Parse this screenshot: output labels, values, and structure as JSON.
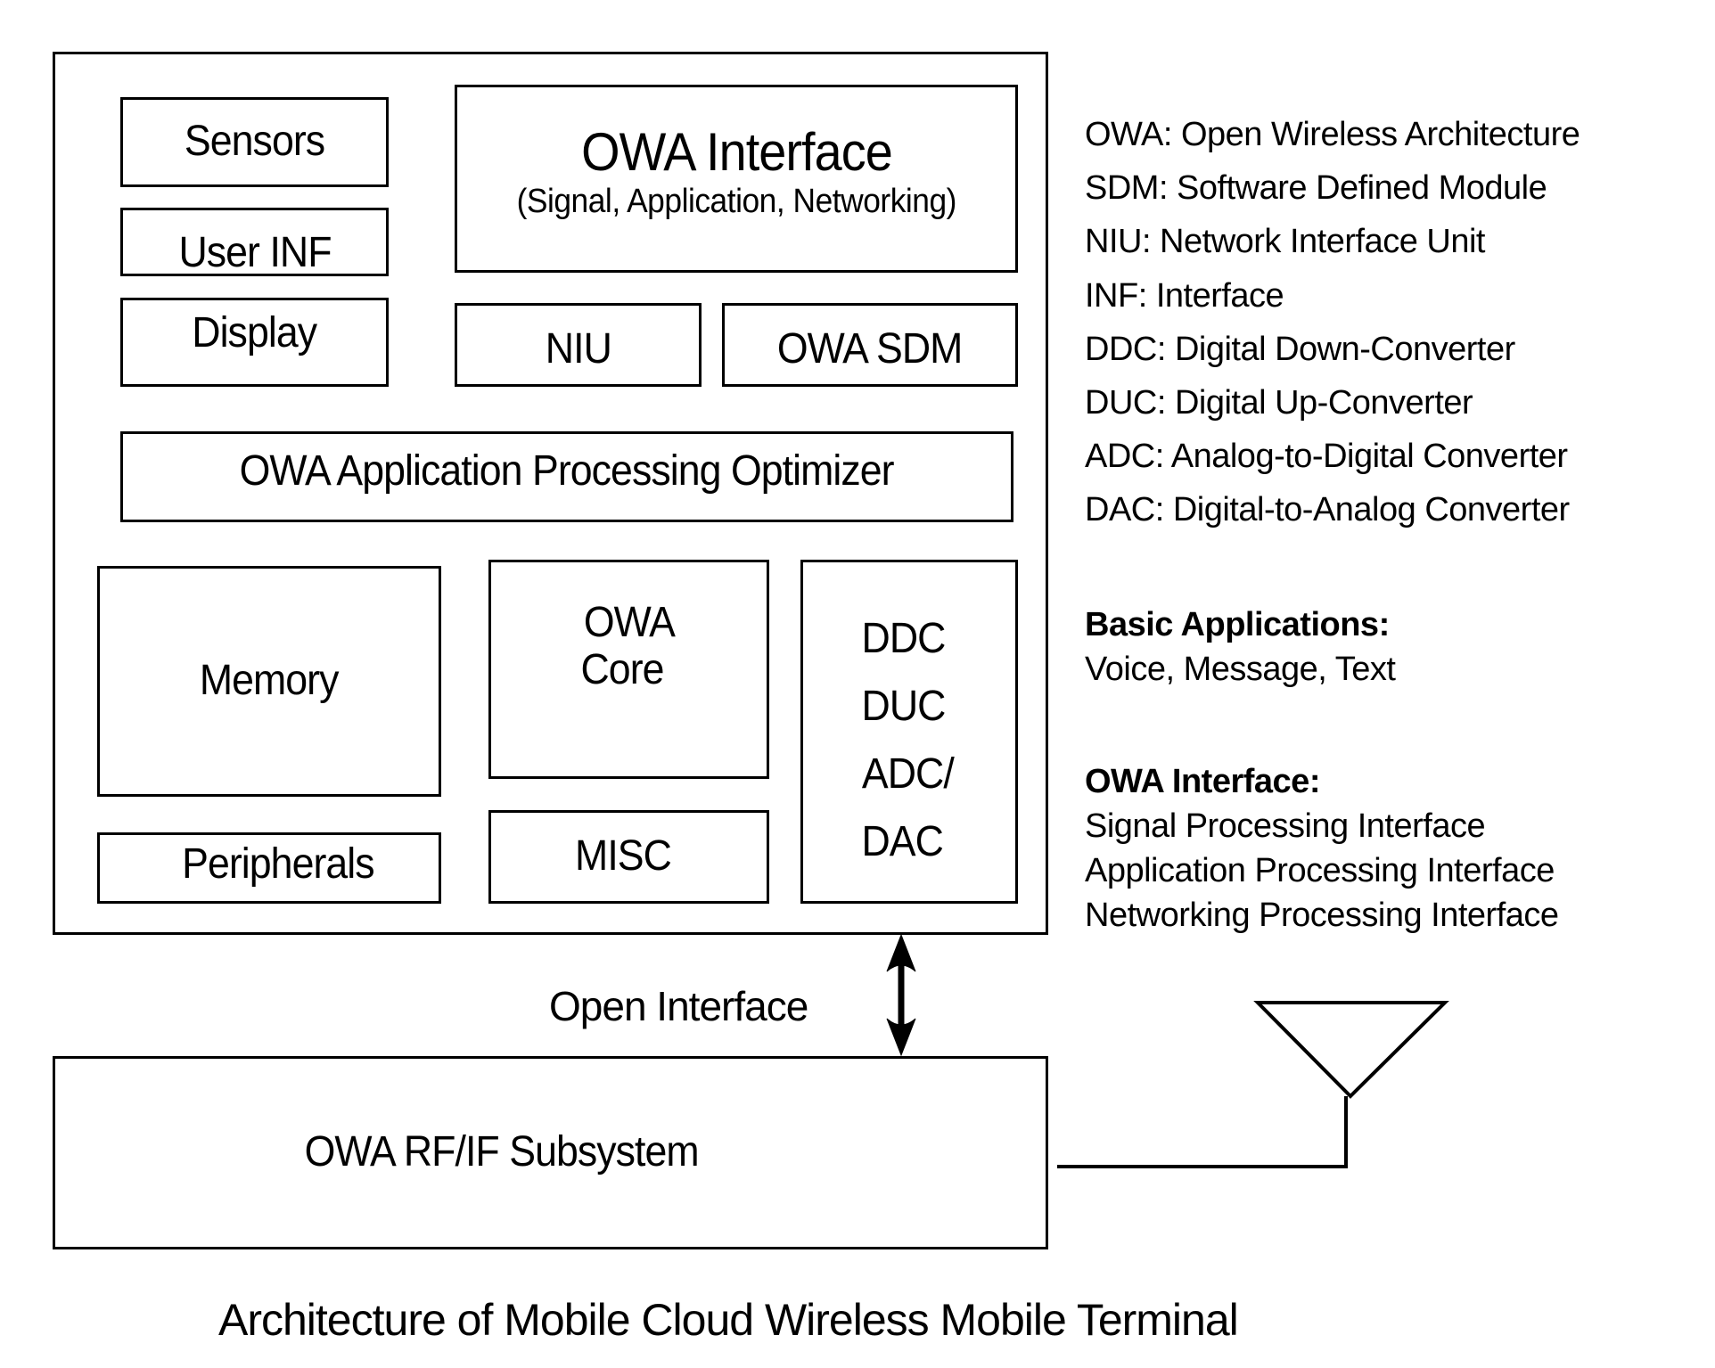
{
  "diagram": {
    "title": "Architecture of Mobile Cloud Wireless Mobile Terminal",
    "terminal_blocks": {
      "sensors": "Sensors",
      "user_inf": "User INF",
      "display": "Display",
      "owa_interface_title": "OWA Interface",
      "owa_interface_sub": "(Signal, Application, Networking)",
      "niu": "NIU",
      "owa_sdm": "OWA SDM",
      "optimizer": "OWA Application Processing Optimizer",
      "memory": "Memory",
      "peripherals": "Peripherals",
      "owa_core": [
        "OWA",
        "Core"
      ],
      "misc": "MISC",
      "converters": [
        "DDC",
        "DUC",
        "ADC/",
        "DAC"
      ]
    },
    "open_interface_label": "Open Interface",
    "rf_subsystem": "OWA RF/IF Subsystem",
    "antenna": "antenna-icon",
    "abbreviations": [
      "OWA: Open Wireless Architecture",
      "SDM: Software Defined Module",
      "NIU: Network Interface Unit",
      "INF: Interface",
      "DDC: Digital Down-Converter",
      "DUC: Digital Up-Converter",
      "ADC: Analog-to-Digital Converter",
      "DAC: Digital-to-Analog Converter"
    ],
    "basic_applications": {
      "heading": "Basic Applications:",
      "items": [
        "Voice, Message, Text"
      ]
    },
    "owa_interface_notes": {
      "heading": "OWA Interface:",
      "items": [
        "Signal Processing Interface",
        "Application Processing Interface",
        "Networking Processing Interface"
      ]
    },
    "colors": {
      "stroke": "#000000",
      "background": "#ffffff"
    }
  }
}
